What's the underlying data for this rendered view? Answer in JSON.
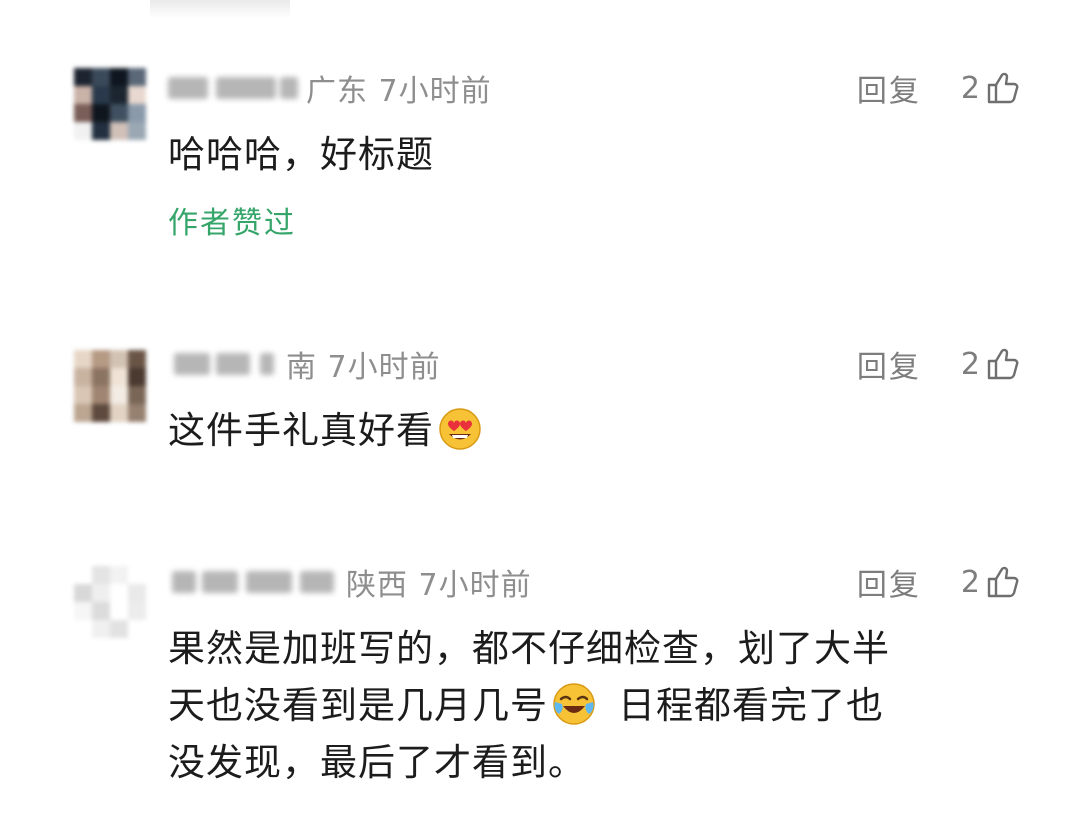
{
  "comments": [
    {
      "location_time": "广东 7小时前",
      "text": "哈哈哈，好标题",
      "reply_label": "回复",
      "likes": "2",
      "author_liked": "作者赞过",
      "avatar_colors": [
        "#1d2430",
        "#3b4a5a",
        "#0f1620",
        "#5a6878",
        "#c9b2a8",
        "#2a3a4c",
        "#1c2630",
        "#e8d8d0",
        "#7a5e58",
        "#10161e",
        "#405060",
        "#8b9aaa",
        "#f1f1f1",
        "#223040",
        "#d0c0b8",
        "#9aa8b4"
      ]
    },
    {
      "location_time": "南 7小时前",
      "text": "这件手礼真好看",
      "emoji": "heart-eyes-emoji",
      "reply_label": "回复",
      "likes": "2",
      "avatar_colors": [
        "#e6d6c6",
        "#b59a84",
        "#d2c2b4",
        "#6a5446",
        "#c8b2a0",
        "#8c7462",
        "#efe3d6",
        "#4a3a30",
        "#d9c6b5",
        "#a08672",
        "#f3ece4",
        "#7a6656",
        "#bca692",
        "#5e4a3e",
        "#e2d3c4",
        "#968070"
      ]
    },
    {
      "location_time": "陕西 7小时前",
      "text_lines": [
        "果然是加班写的，都不仔细检查，划了大半",
        "天也没看到是几月几号",
        "日程都看完了也",
        "没发现，最后了才看到。"
      ],
      "emoji": "crying-laughing-emoji",
      "reply_label": "回复",
      "likes": "2",
      "avatar_colors": [
        "#ffffff",
        "#e4e4e4",
        "#f2f2f2",
        "#ffffff",
        "#d8d8d8",
        "#efefef",
        "#ffffff",
        "#e9e9e9",
        "#f6f6f6",
        "#dcdcdc",
        "#ffffff",
        "#ececec",
        "#ffffff",
        "#f0f0f0",
        "#e2e2e2",
        "#ffffff"
      ]
    }
  ],
  "colors": {
    "author_liked": "#35a56a",
    "meta": "#8e8e8e",
    "text": "#1c1c1c"
  }
}
